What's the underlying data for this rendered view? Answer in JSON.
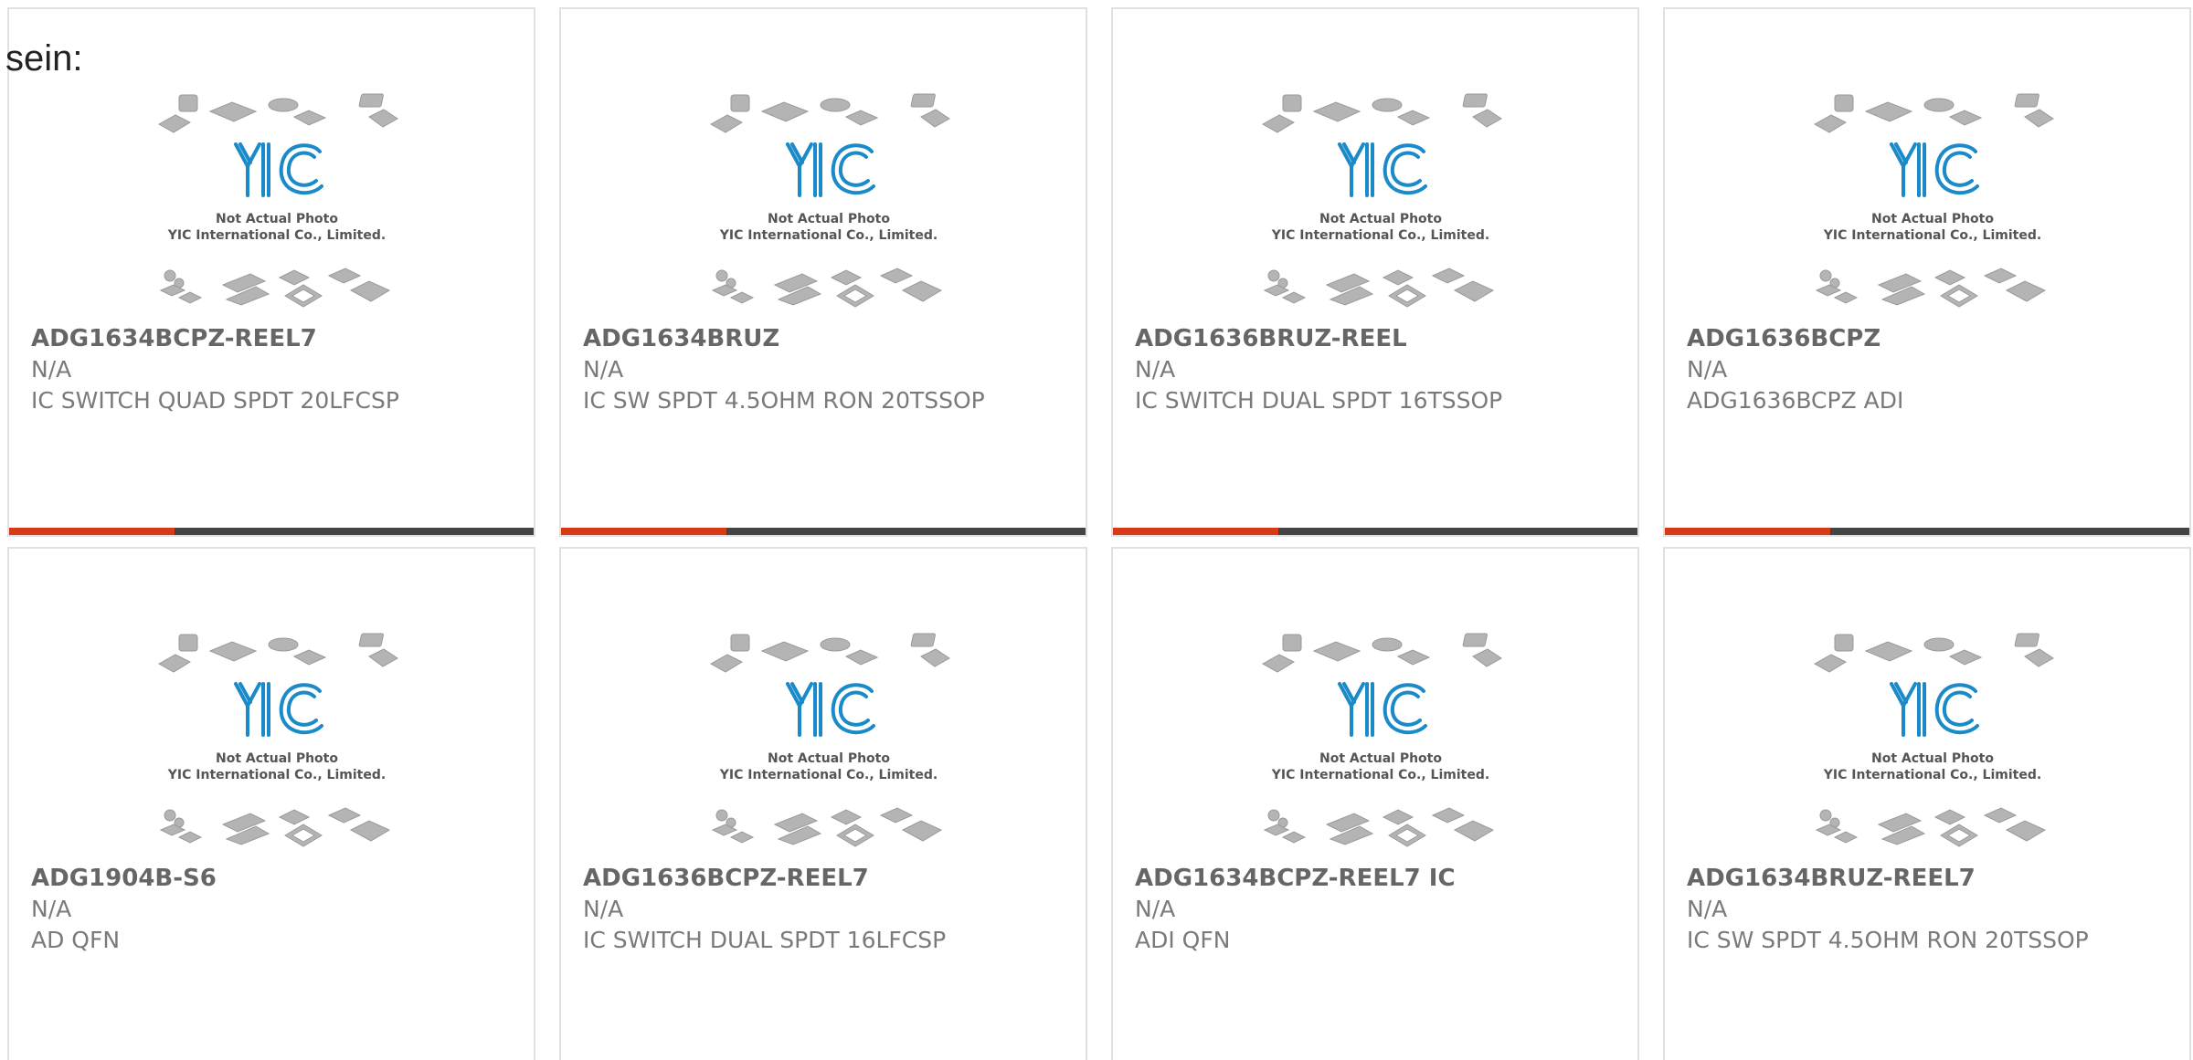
{
  "header": {
    "text": "sein:"
  },
  "placeholder_image": {
    "line1": "Not Actual Photo",
    "line2": "YIC International Co., Limited.",
    "logo_text": "YIC",
    "logo_color": "#1a8ac8"
  },
  "colors": {
    "accent": "#d83a16",
    "bar": "#444444",
    "border": "#e1e1e1",
    "text": "#666666"
  },
  "products": [
    {
      "part": "ADG1634BCPZ-REEL7",
      "manufacturer": "N/A",
      "description": "IC SWITCH QUAD SPDT 20LFCSP"
    },
    {
      "part": "ADG1634BRUZ",
      "manufacturer": "N/A",
      "description": "IC SW SPDT 4.5OHM RON 20TSSOP"
    },
    {
      "part": "ADG1636BRUZ-REEL",
      "manufacturer": "N/A",
      "description": "IC SWITCH DUAL SPDT 16TSSOP"
    },
    {
      "part": "ADG1636BCPZ",
      "manufacturer": "N/A",
      "description": "ADG1636BCPZ ADI"
    },
    {
      "part": "ADG1904B-S6",
      "manufacturer": "N/A",
      "description": "AD QFN"
    },
    {
      "part": "ADG1636BCPZ-REEL7",
      "manufacturer": "N/A",
      "description": "IC SWITCH DUAL SPDT 16LFCSP"
    },
    {
      "part": "ADG1634BCPZ-REEL7 IC",
      "manufacturer": "N/A",
      "description": "ADI QFN"
    },
    {
      "part": "ADG1634BRUZ-REEL7",
      "manufacturer": "N/A",
      "description": "IC SW SPDT 4.5OHM RON 20TSSOP"
    }
  ]
}
